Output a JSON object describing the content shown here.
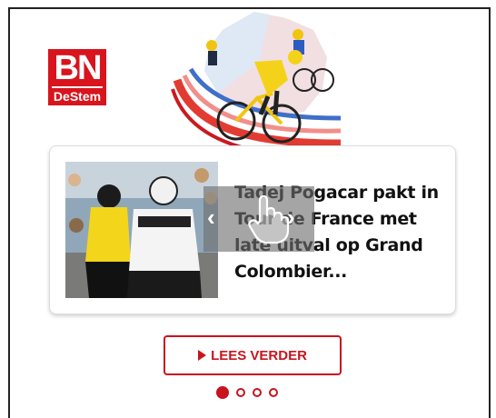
{
  "brand": {
    "logo_line1": "BN",
    "logo_line2": "DeStem",
    "accent": "#d8141d"
  },
  "hero": {
    "icon": "tour-de-france-cyclists-illustration"
  },
  "article": {
    "headline": "Tadej Pogacar pakt in Tour de France met late uitval op Grand Colombier...",
    "photo_icon": "cyclists-photo"
  },
  "carousel": {
    "prev_glyph": "‹",
    "next_glyph": "›",
    "active_index": 0,
    "dot_count": 4
  },
  "cta": {
    "label": "LEES VERDER"
  }
}
